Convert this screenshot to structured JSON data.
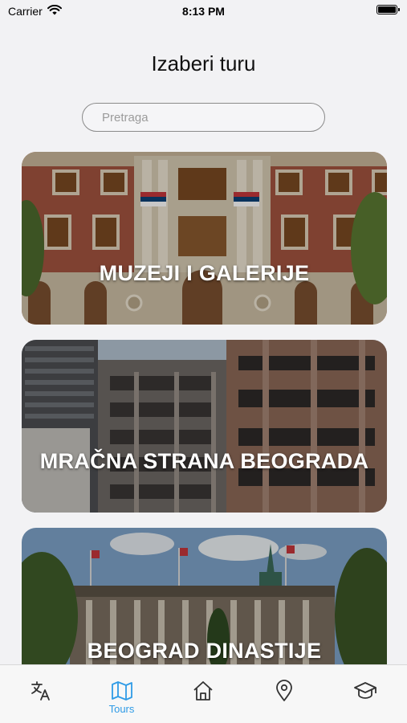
{
  "status_bar": {
    "carrier": "Carrier",
    "time": "8:13 PM"
  },
  "header": {
    "title": "Izaberi turu"
  },
  "search": {
    "placeholder": "Pretraga",
    "value": ""
  },
  "tours": [
    {
      "title": "MUZEJI I GALERIJE",
      "image": "museum-building-facade"
    },
    {
      "title": "MRAČNA STRANA BEOGRADA",
      "image": "bombed-building-ruins"
    },
    {
      "title": "BEOGRAD DINASTIJE",
      "image": "parliament-building"
    }
  ],
  "tab_bar": {
    "active_color": "#2f9be6",
    "items": [
      {
        "icon": "translate-icon",
        "label": ""
      },
      {
        "icon": "map-icon",
        "label": "Tours",
        "active": true
      },
      {
        "icon": "home-icon",
        "label": ""
      },
      {
        "icon": "location-pin-icon",
        "label": ""
      },
      {
        "icon": "graduation-cap-icon",
        "label": ""
      }
    ]
  }
}
